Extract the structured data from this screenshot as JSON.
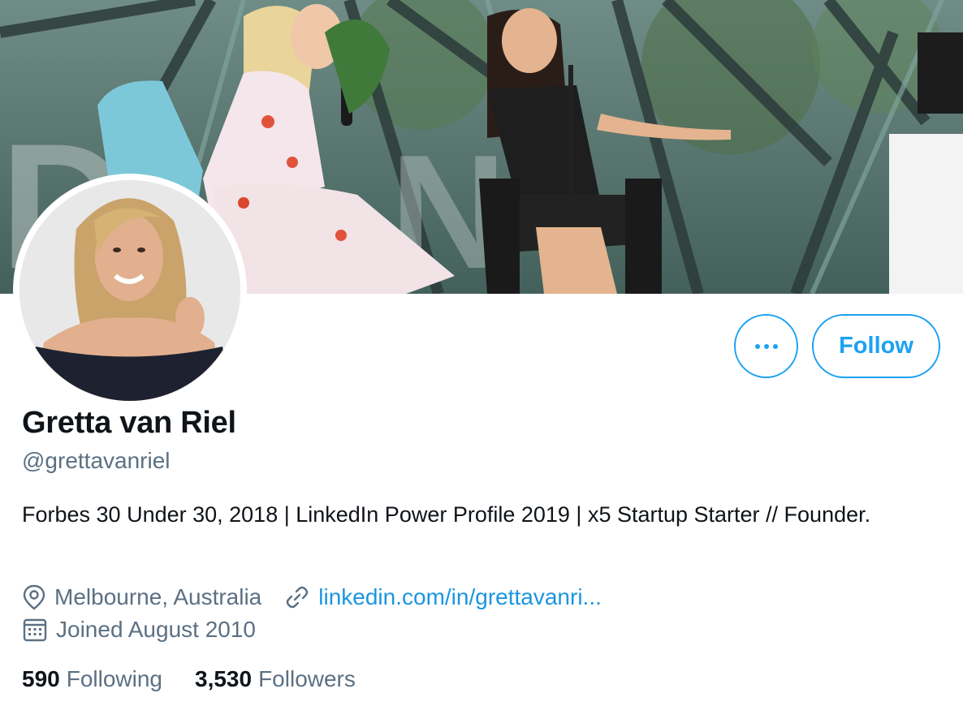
{
  "profile": {
    "display_name": "Gretta van Riel",
    "handle": "@grettavanriel",
    "bio": "Forbes 30 Under 30, 2018 | LinkedIn Power Profile 2019 | x5 Startup Starter // Founder.",
    "location": "Melbourne, Australia",
    "website": "linkedin.com/in/grettavanri...",
    "joined": "Joined August 2010"
  },
  "actions": {
    "follow_label": "Follow"
  },
  "stats": {
    "following_count": "590",
    "following_label": "Following",
    "followers_count": "3,530",
    "followers_label": "Followers"
  },
  "icons": {
    "more": "more-dots-icon",
    "location": "location-pin-icon",
    "link": "link-icon",
    "calendar": "calendar-icon"
  },
  "colors": {
    "accent": "#1da1f2",
    "link": "#1b95e0",
    "secondary_text": "#5b7083",
    "primary_text": "#0f1419"
  }
}
